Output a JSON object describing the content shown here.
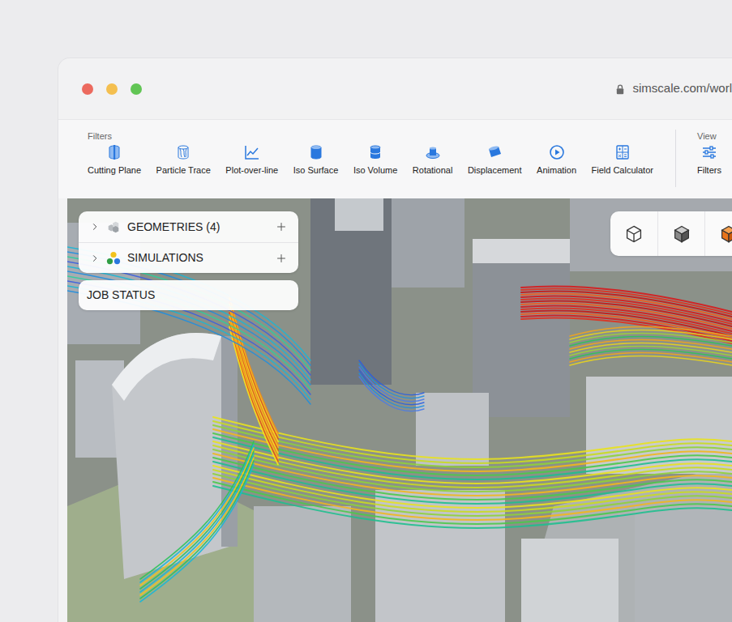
{
  "browser": {
    "url": "simscale.com/worl"
  },
  "toolbar": {
    "filters_heading": "Filters",
    "filters": [
      {
        "label": "Cutting Plane"
      },
      {
        "label": "Particle Trace"
      },
      {
        "label": "Plot-over-line"
      },
      {
        "label": "Iso Surface"
      },
      {
        "label": "Iso Volume"
      },
      {
        "label": "Rotational"
      },
      {
        "label": "Displacement"
      },
      {
        "label": "Animation"
      },
      {
        "label": "Field Calculator"
      }
    ],
    "view_heading": "View",
    "view": [
      {
        "label": "Filters"
      }
    ]
  },
  "tree": [
    {
      "label": "GEOMETRIES",
      "count": "(4)",
      "expanded": false
    },
    {
      "label": "SIMULATIONS",
      "expanded": false
    }
  ],
  "job_status": {
    "label": "JOB STATUS"
  }
}
